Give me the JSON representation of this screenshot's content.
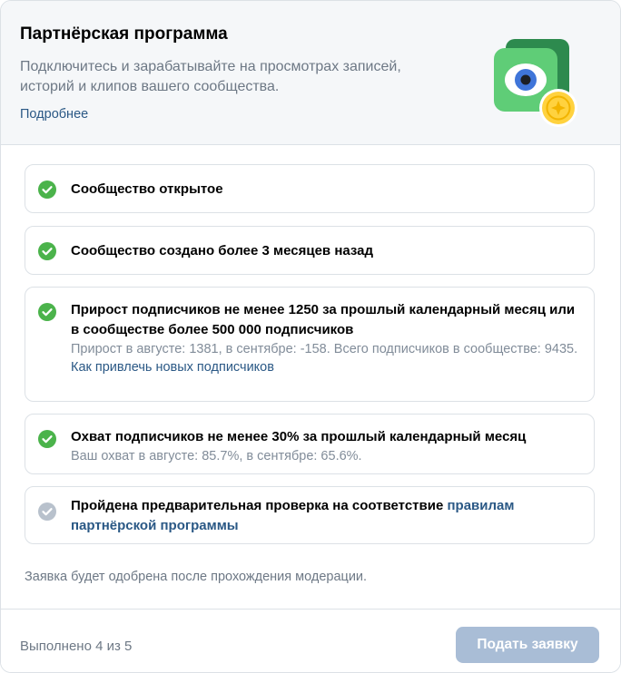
{
  "header": {
    "title": "Партнёрская программа",
    "description": "Подключитесь и зарабатывайте на просмотрах записей, историй и клипов вашего сообщества.",
    "more_link": "Подробнее"
  },
  "requirements": [
    {
      "status": "done",
      "title": "Сообщество открытое"
    },
    {
      "status": "done",
      "title": "Сообщество создано более 3 месяцев назад"
    },
    {
      "status": "done",
      "title": "Прирост подписчиков не менее 1250 за прошлый календарный месяц или в сообществе более 500 000 подписчиков",
      "subtitle": "Прирост в августе: 1381, в сентябре: -158. Всего подписчиков в сообществе: 9435.",
      "link": "Как привлечь новых подписчиков"
    },
    {
      "status": "done",
      "title": "Охват подписчиков не менее 30% за прошлый календарный месяц",
      "subtitle": "Ваш охват в августе: 85.7%, в сентябре: 65.6%."
    },
    {
      "status": "pending",
      "title_prefix": "Пройдена предварительная проверка на соответствие ",
      "title_link": "правилам партнёрской программы"
    }
  ],
  "note": "Заявка будет одобрена после прохождения модерации.",
  "footer": {
    "progress": "Выполнено 4 из 5",
    "submit_label": "Подать заявку"
  },
  "colors": {
    "done": "#4bb34b",
    "pending": "#b8c1cc",
    "link": "#2a5885",
    "button_disabled": "#a9bdd6"
  },
  "icons": {
    "done": "check-circle-icon",
    "pending": "check-circle-grey-icon",
    "illustration": "eye-coin-illustration"
  }
}
